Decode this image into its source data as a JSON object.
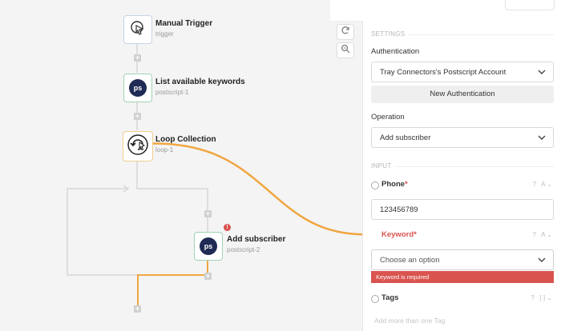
{
  "workflow": {
    "steps": [
      {
        "title": "Manual Trigger",
        "sub": "trigger",
        "icon": "cursor-icon"
      },
      {
        "title": "List available keywords",
        "sub": "postscript-1",
        "icon": "postscript-logo-icon",
        "badge": "ps"
      },
      {
        "title": "Loop Collection",
        "sub": "loop-1",
        "icon": "loop-icon"
      },
      {
        "title": "Add subscriber",
        "sub": "postscript-2",
        "icon": "postscript-logo-icon",
        "badge": "ps"
      }
    ],
    "error_badge": "!",
    "plus": "+"
  },
  "toolbar": {
    "refresh_icon": "refresh-icon",
    "zoom_icon": "zoom-icon"
  },
  "panel": {
    "settings_heading": "SETTINGS",
    "authentication_label": "Authentication",
    "authentication_value": "Tray Connectors's Postscript Account",
    "new_auth_button": "New Authentication",
    "operation_label": "Operation",
    "operation_value": "Add subscriber",
    "input_heading": "INPUT",
    "phone": {
      "label": "Phone",
      "required": "*",
      "value": "123456789",
      "type_icon": "A"
    },
    "keyword": {
      "label": "Keyword",
      "required": "*",
      "placeholder": "Choose an option",
      "error": "Keyword is required",
      "type_icon": "A"
    },
    "tags": {
      "label": "Tags",
      "type_icon": "[ ]",
      "hint": "Add more than one Tag"
    }
  },
  "colors": {
    "accent_orange": "#f0a640",
    "error_red": "#d9534f"
  }
}
